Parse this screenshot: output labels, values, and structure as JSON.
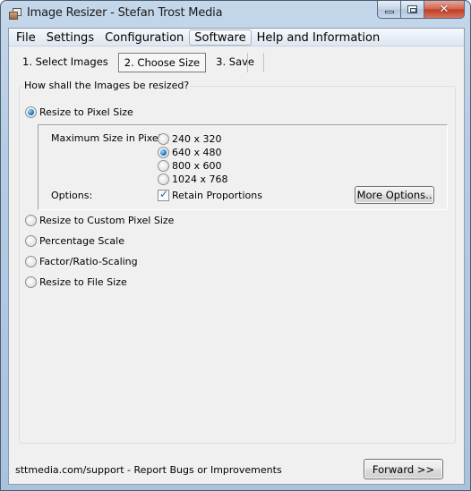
{
  "window": {
    "title": "Image Resizer - Stefan Trost Media",
    "controls": {
      "minimize": "minimize",
      "maximize": "maximize",
      "close": "✕"
    }
  },
  "menu": {
    "items": [
      {
        "label": "File",
        "active": false
      },
      {
        "label": "Settings",
        "active": false
      },
      {
        "label": "Configuration",
        "active": false
      },
      {
        "label": "Software",
        "active": true
      },
      {
        "label": "Help and Information",
        "active": false
      }
    ]
  },
  "tabs": [
    {
      "label": "1. Select Images",
      "selected": false
    },
    {
      "label": "2. Choose Size",
      "selected": true
    },
    {
      "label": "3. Save",
      "selected": false
    }
  ],
  "resize_group": {
    "legend": "How shall the Images be resized?",
    "modes": [
      {
        "label": "Resize to Pixel Size",
        "checked": true
      },
      {
        "label": "Resize to Custom Pixel Size",
        "checked": false
      },
      {
        "label": "Percentage Scale",
        "checked": false
      },
      {
        "label": "Factor/Ratio-Scaling",
        "checked": false
      },
      {
        "label": "Resize to File Size",
        "checked": false
      }
    ],
    "pixel_size": {
      "max_size_label": "Maximum Size in Pixels:",
      "sizes": [
        {
          "label": "240 x 320",
          "checked": false
        },
        {
          "label": "640 x 480",
          "checked": true
        },
        {
          "label": "800 x 600",
          "checked": false
        },
        {
          "label": "1024 x 768",
          "checked": false
        }
      ],
      "options_label": "Options:",
      "retain_proportions": {
        "label": "Retain Proportions",
        "checked": true
      },
      "more_options_button": "More Options.."
    }
  },
  "footer": {
    "support_text": "sttmedia.com/support - Report Bugs or Improvements",
    "forward_button": "Forward >>"
  }
}
